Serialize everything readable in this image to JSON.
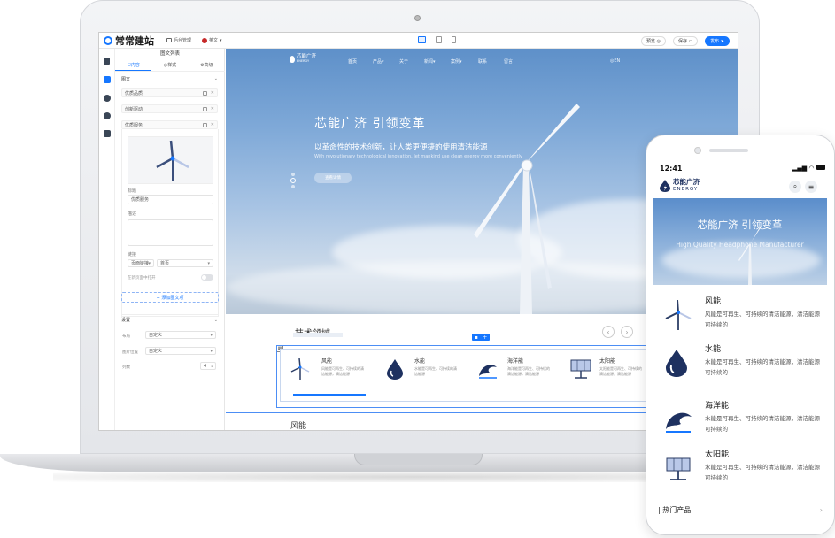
{
  "editor": {
    "brand": "常常建站",
    "back_label": "后台管理",
    "lang_label": "英文",
    "preview_label": "预览",
    "save_label": "保存",
    "publish_label": "发布"
  },
  "panel": {
    "title": "图文列表",
    "tabs": [
      "内容",
      "样式",
      "高级"
    ],
    "section_label": "图文",
    "items": [
      "优质品质",
      "创新驱动",
      "优质服务"
    ],
    "field_title_label": "标题",
    "field_title_value": "优质服务",
    "field_desc_label": "描述",
    "link_label": "链接",
    "link_type": "页面链接",
    "link_target": "首页",
    "new_window_label": "在新页面中打开",
    "add_button": "+ 添加图文项",
    "settings_label": "设置",
    "layout_label": "布局",
    "layout_value": "自定义",
    "align_label": "图片位置",
    "align_value": "自定义",
    "columns_label": "列数",
    "columns_value": "4"
  },
  "site": {
    "logo_cn": "芯能广济",
    "logo_en": "ENERGY",
    "nav": [
      "首页",
      "产品",
      "关于",
      "新闻",
      "案例",
      "联系",
      "留言"
    ],
    "lang": "EN",
    "hero_title": "芯能广济   引领变革",
    "hero_subtitle": "以革命性的技术创新，让人类更便捷的使用清洁能源",
    "hero_en": "With revolutionary technological innovation, let mankind use clean energy more conveniently",
    "hero_button": "查看详情",
    "section_title": "技术领域",
    "next_section": "风能",
    "tech": [
      {
        "title": "风能",
        "desc": "风能是可再生、可持续的清洁能源，清洁能源"
      },
      {
        "title": "水能",
        "desc": "水能是可再生、可持续的清洁能源"
      },
      {
        "title": "海洋能",
        "desc": "海洋能是可再生、可持续的清洁能源，清洁能源"
      },
      {
        "title": "太阳能",
        "desc": "太阳能是可再生、可持续的清洁能源，清洁能源"
      }
    ]
  },
  "phone": {
    "time": "12:41",
    "logo_cn": "芯能广济",
    "logo_en": "ENERGY",
    "banner_title": "芯能广济   引领变革",
    "banner_en": "High Quality Headphone Manufacturer",
    "items": [
      {
        "title": "风能",
        "desc": "风能是可再生、可持续的清洁能源，清洁能源可持续的"
      },
      {
        "title": "水能",
        "desc": "水能是可再生、可持续的清洁能源，清洁能源可持续的"
      },
      {
        "title": "海洋能",
        "desc": "水能是可再生、可持续的清洁能源，清洁能源可持续的"
      },
      {
        "title": "太阳能",
        "desc": "水能是可再生、可持续的清洁能源，清洁能源可持续的"
      }
    ],
    "hot_products": "| 热门产品"
  },
  "colors": {
    "accent": "#1677ff",
    "icon_dark": "#2c3e66",
    "hero_sky": "#6f9dd3"
  }
}
